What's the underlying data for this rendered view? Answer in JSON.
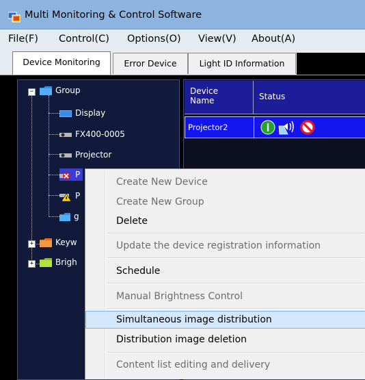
{
  "window": {
    "title": "Multi Monitoring & Control Software"
  },
  "menubar": {
    "items": [
      "File(F)",
      "Control(C)",
      "Options(O)",
      "View(V)",
      "About(A)"
    ]
  },
  "tabs": [
    {
      "label": "Device Monitoring",
      "active": true
    },
    {
      "label": "Error Device",
      "active": false
    },
    {
      "label": "Light ID Information",
      "active": false
    }
  ],
  "tree": {
    "group": {
      "label": "Group",
      "icon": "folder-icon"
    },
    "children": [
      {
        "label": "Display",
        "icon": "display-icon"
      },
      {
        "label": "FX400-0005",
        "icon": "projector-icon"
      },
      {
        "label": "Projector",
        "icon": "projector-icon"
      },
      {
        "label": "P",
        "icon": "projector-error-icon"
      },
      {
        "label": "P",
        "icon": "projector-warning-icon"
      },
      {
        "label": "g",
        "icon": "folder-icon"
      }
    ],
    "roots": [
      {
        "label": "Keyw",
        "icon": "folder-icon"
      },
      {
        "label": "Brigh",
        "icon": "folder-icon"
      }
    ]
  },
  "grid": {
    "columns": [
      "Device Name",
      "Status"
    ],
    "rows": [
      {
        "name": "Projector2",
        "status_icons": [
          "power-on-icon",
          "audio-icon",
          "prohibited-icon"
        ]
      }
    ]
  },
  "context_menu": {
    "items": [
      {
        "label": "Create New Device",
        "enabled": false
      },
      {
        "label": "Create New Group",
        "enabled": false
      },
      {
        "label": "Delete",
        "enabled": true
      },
      {
        "label": "Update the device registration information",
        "enabled": false
      },
      {
        "label": "Schedule",
        "enabled": true
      },
      {
        "label": "Manual Brightness Control",
        "enabled": false
      },
      {
        "label": "Simultaneous image distribution",
        "enabled": true,
        "highlighted": true
      },
      {
        "label": "Distribution image deletion",
        "enabled": true
      },
      {
        "label": "Content list editing and delivery",
        "enabled": false
      }
    ]
  },
  "colors": {
    "titlebar": "#8db4de",
    "tree_background": "#111a3a",
    "grid_header": "#1d1d9a",
    "selected_row": "#1414ee",
    "menu_highlight": "#d5e7fb"
  }
}
